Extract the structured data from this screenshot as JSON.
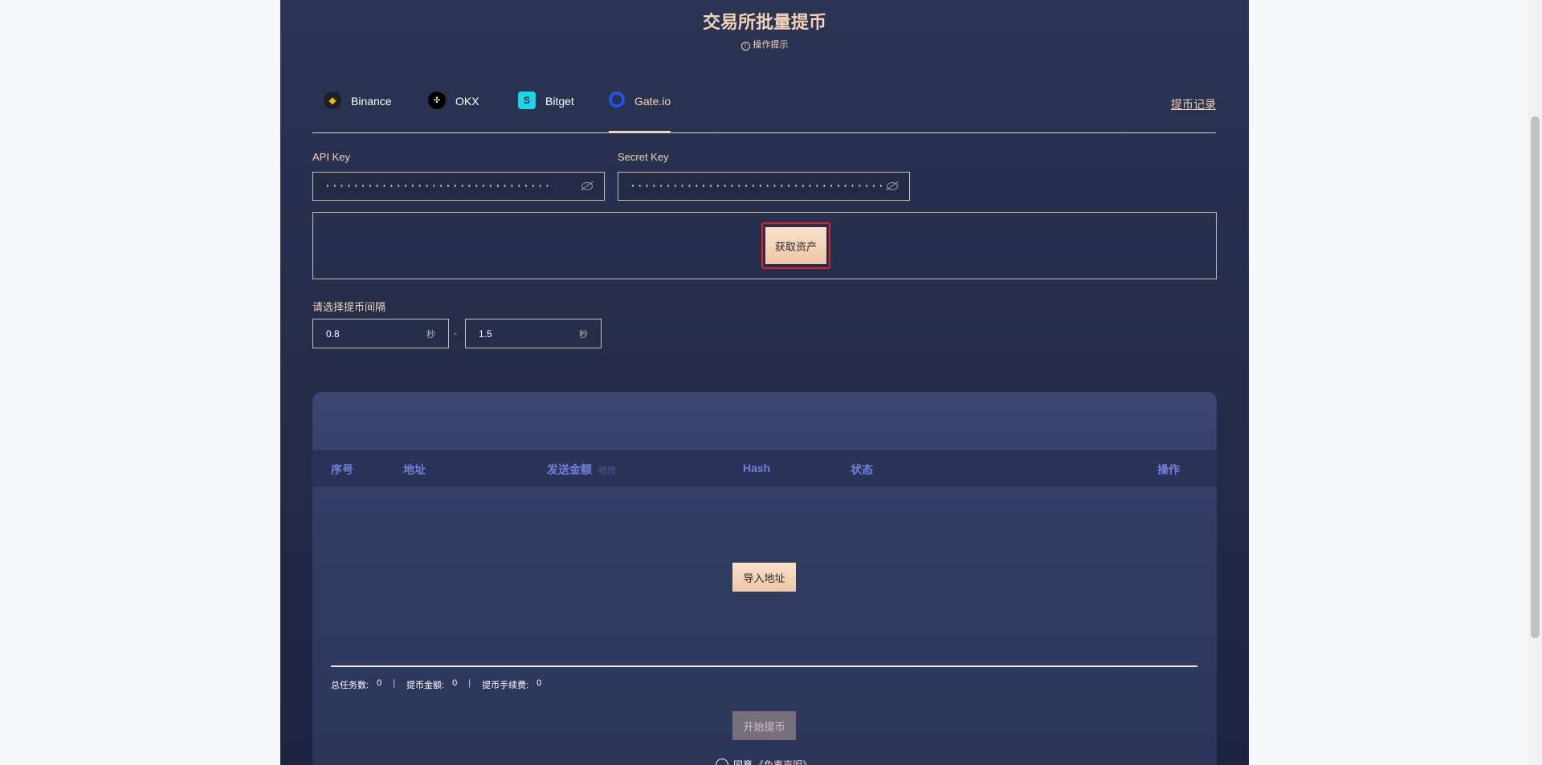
{
  "page": {
    "title": "交易所批量提币",
    "tip": "操作提示"
  },
  "tabs": [
    {
      "label": "Binance",
      "icon": "binance-icon",
      "color": "#f0b90b"
    },
    {
      "label": "OKX",
      "icon": "okx-icon",
      "color": "#000000"
    },
    {
      "label": "Bitget",
      "icon": "bitget-icon",
      "color": "#1dd5e6"
    },
    {
      "label": "Gate.io",
      "icon": "gateio-icon",
      "color": "#2354e6",
      "active": true
    }
  ],
  "records_link": "提币记录",
  "api": {
    "api_key_label": "API Key",
    "api_key_value": "································",
    "secret_key_label": "Secret Key",
    "secret_key_value": "················································"
  },
  "fetch_assets_button": "获取资产",
  "interval": {
    "label": "请选择提币间隔",
    "min": "0.8",
    "max": "1.5",
    "unit": "秒",
    "separator": "-"
  },
  "table": {
    "columns": [
      "序号",
      "地址",
      "发送金额",
      "Hash",
      "状态",
      "操作"
    ],
    "amount_edit": "修改"
  },
  "import_button": "导入地址",
  "stats": {
    "total_label": "总任务数:",
    "total_value": "0",
    "amount_label": "提币金额:",
    "amount_value": "0",
    "fee_label": "提币手续费:",
    "fee_value": "0"
  },
  "start_button": "开始提币",
  "agree": {
    "text": "同意",
    "link": "《免责声明》"
  },
  "colors": {
    "accent": "#f2d3b8",
    "panel": "#2c3454",
    "column_header": "#7080dc",
    "highlight": "#e02020"
  }
}
